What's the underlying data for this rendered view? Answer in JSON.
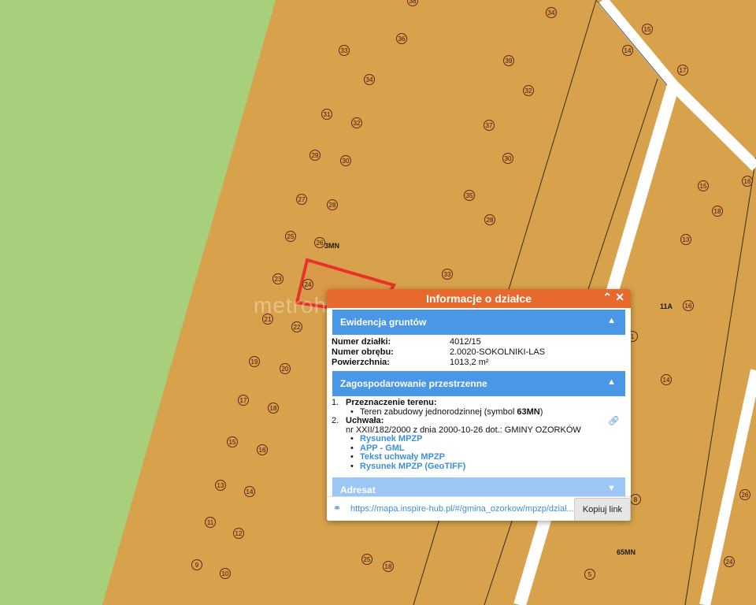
{
  "map": {
    "colors": {
      "green_area": "#a8cf7b",
      "build_area": "#d7a24b",
      "road": "#ffffff",
      "parcel_outline": "#e8312a"
    },
    "zone_labels": [
      "3MN",
      "65MN",
      "11A"
    ],
    "lot_numbers": [
      "38",
      "34",
      "36",
      "15",
      "33",
      "14",
      "39",
      "17",
      "34",
      "32",
      "31",
      "32",
      "37",
      "29",
      "30",
      "30",
      "16",
      "15",
      "27",
      "28",
      "35",
      "18",
      "28",
      "13",
      "25",
      "26",
      "33",
      "23",
      "24",
      "16",
      "21",
      "22",
      "1",
      "19",
      "20",
      "14",
      "17",
      "18",
      "15",
      "16",
      "8",
      "13",
      "14",
      "26",
      "11",
      "12",
      "9",
      "10",
      "25",
      "18",
      "5",
      "24"
    ]
  },
  "watermark": "metrohouse",
  "popup": {
    "title": "Informacje o działce",
    "minimize_icon": "chevron-up-icon",
    "close_icon": "close-icon",
    "sections": {
      "ewidencja": {
        "title": "Ewidencja gruntów",
        "rows": [
          {
            "label": "Numer działki:",
            "value": "4012/15"
          },
          {
            "label": "Numer obrębu:",
            "value": "2.0020-SOKOLNIKI-LAS"
          },
          {
            "label": "Powierzchnia:",
            "value": "1013,2 m²"
          }
        ]
      },
      "zagospodarowanie": {
        "title": "Zagospodarowanie przestrzenne",
        "item1_num": "1.",
        "item1_title": "Przeznaczenie terenu:",
        "item1_desc_prefix": "Teren zabudowy jednorodzinnej (symbol ",
        "item1_symbol": "63MN",
        "item1_desc_suffix": ")",
        "item2_num": "2.",
        "item2_title": "Uchwała:",
        "item2_desc": "nr XXII/182/2000 z dnia 2000-10-26 dot.: GMINY OZORKÓW",
        "links": [
          "Rysunek MPZP",
          "APP - GML",
          "Tekst uchwały MPZP",
          "Rysunek MPZP (GeoTIFF)"
        ]
      },
      "adresat": {
        "title": "Adresat"
      }
    },
    "footer": {
      "url": "https://mapa.inspire-hub.pl/#/gmina_ozorkow/mpzp/dzial...",
      "copy_button": "Kopiuj link"
    }
  }
}
